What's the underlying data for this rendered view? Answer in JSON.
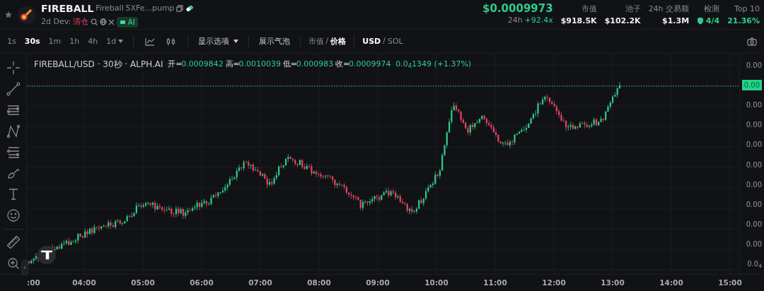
{
  "header": {
    "symbol": "FIREBALL",
    "name": "Fireball",
    "address": "5XFe...pump",
    "dev_label": "2d Dev:",
    "dev_status": "清仓",
    "ai_badge": "AI",
    "price": "$0.0009973",
    "change_label": "24h",
    "change": "+92.4x",
    "stats": [
      {
        "label": "市值",
        "value": "$918.5K",
        "kind": "plain"
      },
      {
        "label": "池子",
        "value": "$102.2K",
        "kind": "plain"
      },
      {
        "label": "24h 交易额",
        "value": "$1.3M",
        "kind": "plain"
      },
      {
        "label": "检测",
        "value": "4/4",
        "kind": "check"
      },
      {
        "label": "Top 10",
        "value": "21.36%",
        "kind": "percent"
      }
    ]
  },
  "toolbar": {
    "intervals": [
      {
        "label": "1s",
        "selected": false
      },
      {
        "label": "30s",
        "selected": true
      },
      {
        "label": "1m",
        "selected": false
      },
      {
        "label": "1h",
        "selected": false
      },
      {
        "label": "4h",
        "selected": false
      },
      {
        "label": "1d",
        "selected": false,
        "kind": "dropdown"
      }
    ],
    "display_options": "显示选项",
    "bubbles": "展示气泡",
    "toggles": [
      {
        "separator": "/",
        "options": [
          {
            "label": "市值",
            "selected": false
          },
          {
            "label": "价格",
            "selected": true
          }
        ]
      },
      {
        "separator": "/",
        "options": [
          {
            "label": "USD",
            "selected": true
          },
          {
            "label": "SOL",
            "selected": false
          }
        ]
      }
    ]
  },
  "legend": {
    "title": "FIREBALL/USD · 30秒 · ALPH.AI",
    "fields": [
      {
        "label": "开=",
        "value": "0.0009842"
      },
      {
        "label": "高=",
        "value": "0.0010039"
      },
      {
        "label": "低=",
        "value": "0.000983"
      },
      {
        "label": "收=",
        "value": "0.0009974"
      }
    ],
    "change": "0.0$_{4}$1349 (+1.37%)"
  },
  "price_axis": [
    {
      "text": "0.00",
      "kind": "tick"
    },
    {
      "text": "0.00",
      "kind": "current"
    },
    {
      "text": "0.00",
      "kind": "tick"
    },
    {
      "text": "0.00",
      "kind": "tick"
    },
    {
      "text": "0.00",
      "kind": "tick"
    },
    {
      "text": "0.00",
      "kind": "tick"
    },
    {
      "text": "0.00",
      "kind": "tick"
    },
    {
      "text": "0.00",
      "kind": "tick"
    },
    {
      "text": "0.00",
      "kind": "tick"
    },
    {
      "text": "0.00",
      "kind": "tick"
    },
    {
      "text": "0.0$_{4}$",
      "kind": "tick"
    }
  ],
  "time_axis": [
    ":00",
    "04:00",
    "05:00",
    "06:00",
    "07:00",
    "08:00",
    "09:00",
    "10:00",
    "11:00",
    "12:00",
    "13:00",
    "14:00",
    "15:00"
  ],
  "collapse": "‹"
}
